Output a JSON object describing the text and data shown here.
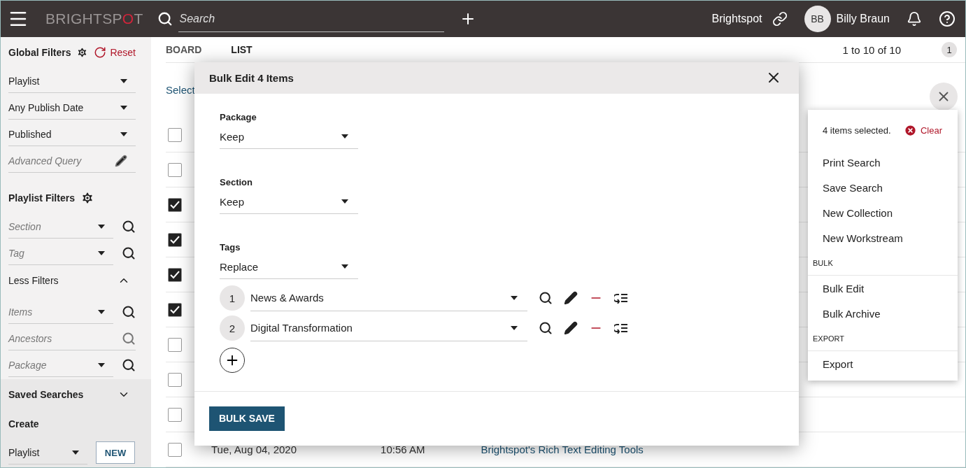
{
  "header": {
    "logo": [
      "BRIGHTSP",
      "O",
      "T"
    ],
    "search": {
      "placeholder": "Search"
    },
    "site": "Brightspot",
    "user": {
      "initials": "BB",
      "name": "Billy Braun"
    }
  },
  "sidebar": {
    "global_filters": {
      "title": "Global Filters",
      "reset": "Reset",
      "fields": [
        {
          "kind": "select",
          "value": "Playlist"
        },
        {
          "kind": "select",
          "value": "Any Publish Date"
        },
        {
          "kind": "select",
          "value": "Published"
        },
        {
          "kind": "query",
          "placeholder": "Advanced Query"
        }
      ]
    },
    "playlist_filters": {
      "title": "Playlist Filters",
      "fields": [
        {
          "kind": "select_search",
          "placeholder": "Section"
        },
        {
          "kind": "select_search",
          "placeholder": "Tag"
        }
      ],
      "less_filters": {
        "label": "Less Filters",
        "expanded": true
      },
      "more_fields": [
        {
          "kind": "select_search",
          "placeholder": "Items"
        },
        {
          "kind": "search",
          "placeholder": "Ancestors"
        },
        {
          "kind": "select_search",
          "placeholder": "Package"
        }
      ]
    },
    "saved_searches": {
      "label": "Saved Searches",
      "expanded": false
    },
    "create": {
      "title": "Create",
      "type": "Playlist",
      "button": "NEW"
    }
  },
  "main": {
    "tabs": [
      {
        "label": "BOARD",
        "selected": false
      },
      {
        "label": "LIST",
        "selected": true
      }
    ],
    "pagination": "1 to 10 of 10",
    "page": "1",
    "select_link": "Select",
    "rows": [
      {
        "checked": false
      },
      {
        "checked": false
      },
      {
        "checked": true
      },
      {
        "checked": true
      },
      {
        "checked": true
      },
      {
        "checked": true
      },
      {
        "checked": false
      },
      {
        "checked": false
      },
      {
        "checked": false
      },
      {
        "checked": false,
        "date": "Tue, Aug 04, 2020",
        "time": "10:56 AM",
        "title": "Brightspot's Rich Text Editing Tools"
      }
    ]
  },
  "modal": {
    "title": "Bulk Edit 4 Items",
    "fields": [
      {
        "label": "Package",
        "value": "Keep"
      },
      {
        "label": "Section",
        "value": "Keep"
      },
      {
        "label": "Tags",
        "value": "Replace"
      }
    ],
    "tag_items": [
      {
        "number": "1",
        "value": "News & Awards"
      },
      {
        "number": "2",
        "value": "Digital Transformation"
      }
    ],
    "save": "BULK SAVE"
  },
  "menu": {
    "summary": "4 items selected.",
    "clear": "Clear",
    "items": [
      {
        "kind": "item",
        "label": "Print Search"
      },
      {
        "kind": "item",
        "label": "Save Search"
      },
      {
        "kind": "item",
        "label": "New Collection"
      },
      {
        "kind": "item",
        "label": "New Workstream"
      },
      {
        "kind": "heading",
        "label": "BULK"
      },
      {
        "kind": "item",
        "label": "Bulk Edit"
      },
      {
        "kind": "item",
        "label": "Bulk Archive"
      },
      {
        "kind": "heading",
        "label": "EXPORT"
      },
      {
        "kind": "item",
        "label": "Export"
      }
    ]
  }
}
